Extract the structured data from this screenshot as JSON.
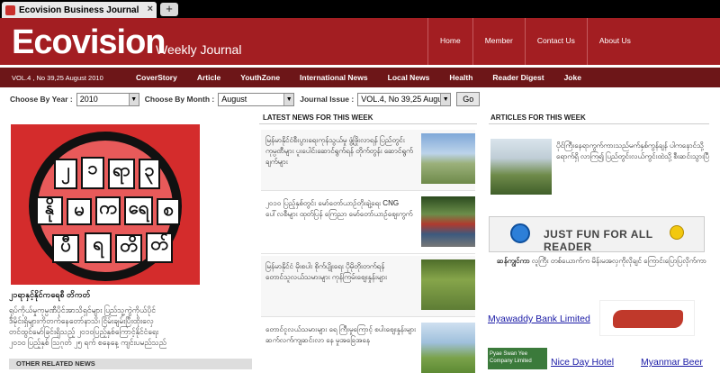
{
  "tab": {
    "title": "Ecovision Business Journal",
    "new_tab": "+",
    "close": "×"
  },
  "header": {
    "logo": "Ecovision",
    "tagline": "Weekly Journal",
    "nav": [
      "Home",
      "Member",
      "Contact Us",
      "About Us"
    ]
  },
  "main_nav": {
    "volume": "VOL.4 , No 39,25 August 2010",
    "items": [
      "CoverStory",
      "Article",
      "YouthZone",
      "International News",
      "Local News",
      "Health",
      "Reader Digest",
      "Joke"
    ]
  },
  "filters": {
    "year_label": "Choose By Year :",
    "year_value": "2010",
    "month_label": "Choose By Month :",
    "month_value": "August",
    "issue_label": "Journal Issue :",
    "issue_value": "VOL.4, No 39,25 Augu",
    "go": "Go"
  },
  "cover": {
    "glyphs": [
      "၂",
      "၁",
      "ရာ",
      "၃",
      "နို",
      "မ",
      "က",
      "ရေ",
      "စ",
      "ပီ",
      "ရ",
      "တိ",
      "တ်"
    ],
    "caption": "၂၁ရာနှင့်နိုင်ကရေစီ တိကတ်",
    "lines": [
      "ရုပ်ကိုယ်မှုကုမ္ပဏီပိုင်အာသိရှင်များ ပြည်သူ့ကွဲကိုယ်ပိုင်",
      "ဒီမိုင်းရှိများကိုတက်နေတော်နာသိ၊ ငြိမ်းချမ်းပြီးထိုးလှေ",
      "တင်ထွင်မော်ခြင်းရှိသည့် ၂၀၁၀ပြည့်နှစ်ကြောင့်နိုင်ငံရေး",
      "၂၀၁၀ ပြည့်နှစ် ဩဂုတ် ၂၅ ရက် စနေနေ့ ကျင်းပမည်သည်"
    ]
  },
  "latest": {
    "heading": "LATEST NEWS FOR THIS WEEK",
    "items": [
      {
        "text": "မြန်မာနိုင်ငံစီးပွားရေးကုန်သွယ်မှု ဖွံ့ဖြိုးလာရန် ပြည်တွင်းကုမ္ပဏီများ ပူးပေါင်းဆောင်ရွက်ရန် တိုက်တွန်း ဆောင်ရွက်ချက်များ"
      },
      {
        "text": "၂၀၁၀ ပြည့်နှစ်တွင်း မော်တော်ယာဉ်တိုးချဲ့ရေး CNG ပေါ်လစီများ ထုတ်ပြန် ကြေညာ မော်တော်ယာဉ်ဈေးကွက်"
      },
      {
        "text": "မြန်မာနိုင်ငံ မိုးစပါး စိုက်ပျိုးရေး ပိုမိုတိုးတက်ရန် တောင်သူလယ်သမားများ ကုန်ကြမ်းဈေးနှုန်းများ"
      },
      {
        "text": "တောင်ငူလယ်သမားများ ရေ ကြီးမှုကြောင့် စပါးဈေးနှုန်းများ ဆက်လက်ကျဆင်းလာ နေ မှုအခြေအနေ"
      }
    ]
  },
  "articles": {
    "heading": "ARTICLES FOR THIS WEEK",
    "feature": "ပိုင်ကြီးနေရာကွက်ကားသည်မက်နှစ်ကွန်ချန် ပါကနောင်သို့ရောက်ရှိ လာကြ၍ ပြည်တွင်းလယ်ကွင်းထဲသို့ စီးဆင်းသွားပြီ",
    "ad_text": "JUST FUN FOR ALL READER",
    "joke_title": "ဆန်ကျွင်ကာ",
    "joke_text": "လူကြီး တစ်ယောက်က မိန်းမအလှကိုလိုချင် ကြောင်းပြောပြလိုက်ကာ",
    "links": [
      "Myawaddy Bank Limited",
      "Nice Day Hotel",
      "Myanmar Beer"
    ],
    "sponsor": "Pyae Swan Yee Company Limited"
  },
  "related": "OTHER RELATED NEWS"
}
